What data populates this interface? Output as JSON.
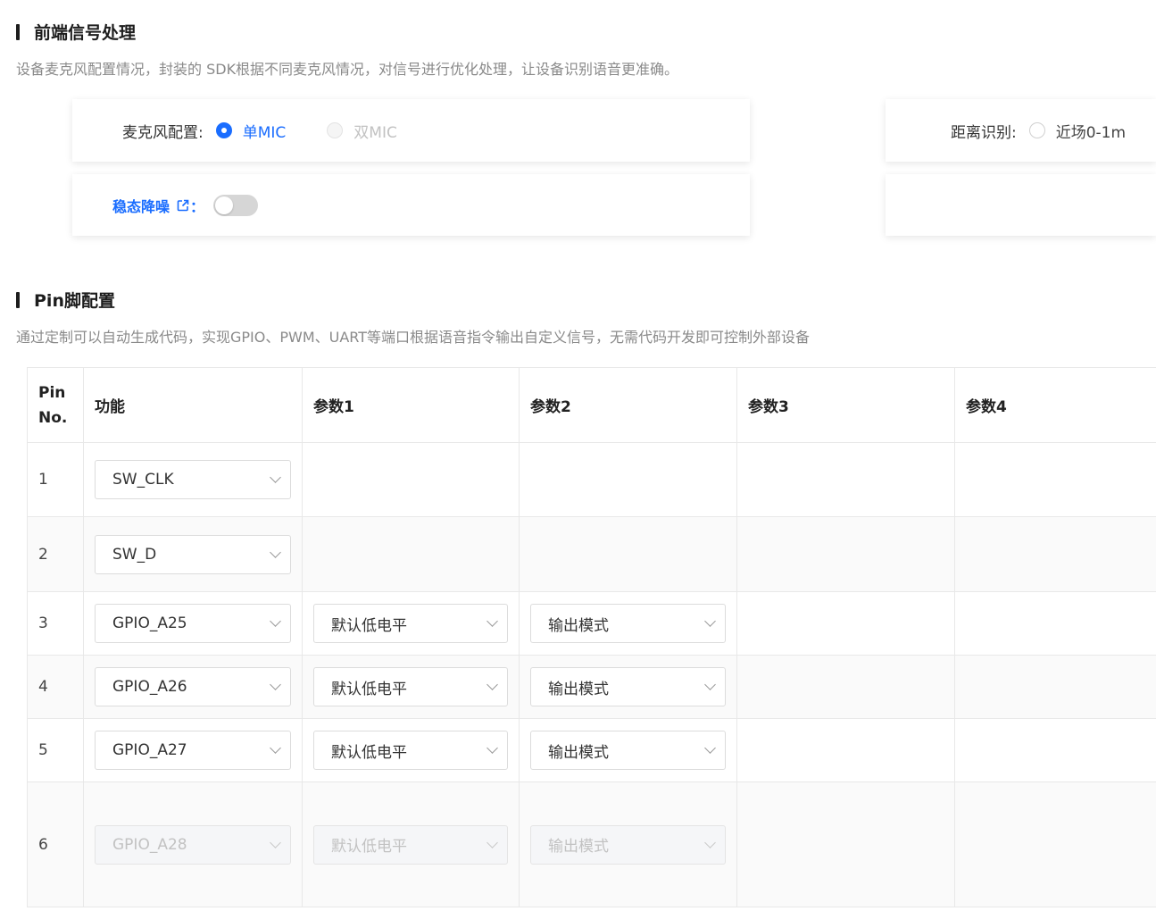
{
  "frontend": {
    "title": "前端信号处理",
    "desc": "设备麦克风配置情况，封装的 SDK根据不同麦克风情况，对信号进行优化处理，让设备识别语音更准确。",
    "mic_label": "麦克风配置:",
    "mic_options": [
      "单MIC",
      "双MIC"
    ],
    "mic_selected": "单MIC",
    "distance_label": "距离识别:",
    "distance_option": "近场0-1m",
    "noise_label": "稳态降噪",
    "noise_colon": "：",
    "noise_enabled": false
  },
  "pins": {
    "title": "Pin脚配置",
    "desc": "通过定制可以自动生成代码，实现GPIO、PWM、UART等端口根据语音指令输出自定义信号，无需代码开发即可控制外部设备",
    "headers": [
      "Pin\nNo.",
      "功能",
      "参数1",
      "参数2",
      "参数3",
      "参数4"
    ],
    "rows": [
      {
        "no": "1",
        "func": "SW_CLK",
        "p1": "",
        "p2": ""
      },
      {
        "no": "2",
        "func": "SW_D",
        "p1": "",
        "p2": ""
      },
      {
        "no": "3",
        "func": "GPIO_A25",
        "p1": "默认低电平",
        "p2": "输出模式"
      },
      {
        "no": "4",
        "func": "GPIO_A26",
        "p1": "默认低电平",
        "p2": "输出模式"
      },
      {
        "no": "5",
        "func": "GPIO_A27",
        "p1": "默认低电平",
        "p2": "输出模式"
      },
      {
        "no": "6",
        "func": "GPIO_A28",
        "p1": "默认低电平",
        "p2": "输出模式",
        "disabled": true
      }
    ]
  },
  "colors": {
    "accent": "#1a6dff",
    "muted": "#8a8a8a"
  }
}
